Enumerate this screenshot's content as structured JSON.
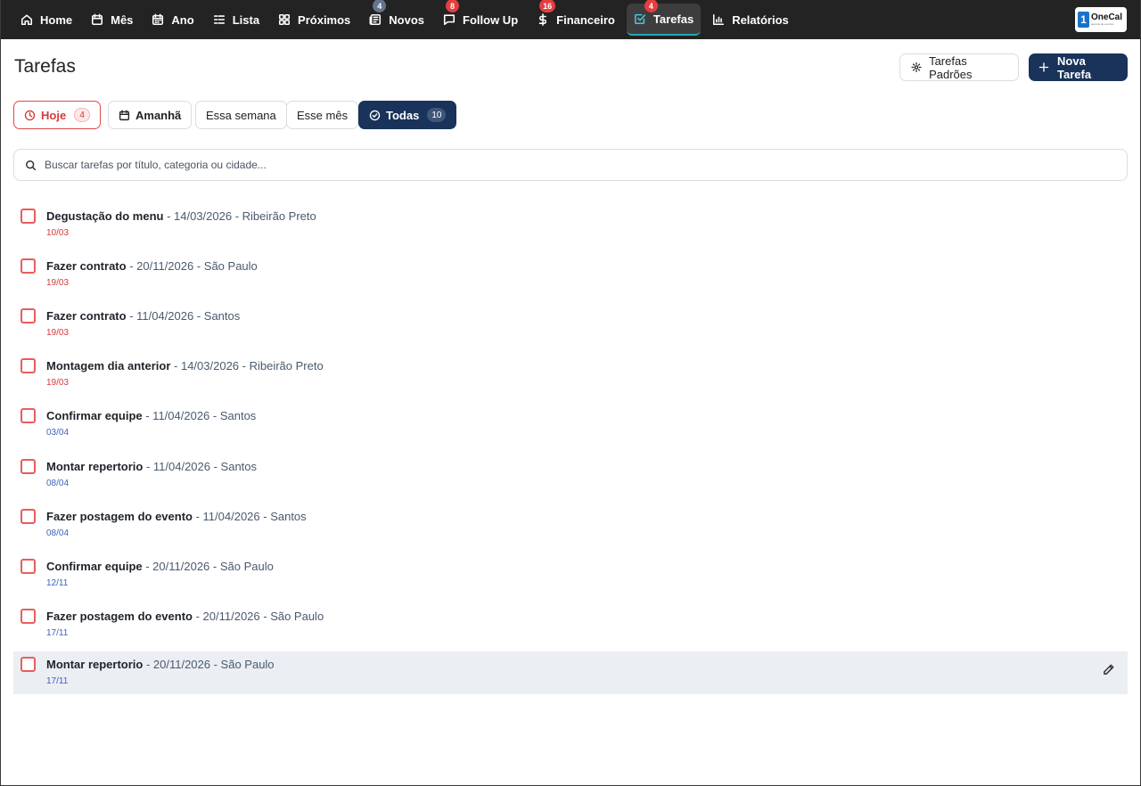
{
  "nav": {
    "items": [
      {
        "label": "Home",
        "icon": "home-icon"
      },
      {
        "label": "Mês",
        "icon": "calendar-icon"
      },
      {
        "label": "Ano",
        "icon": "calendar-grid-icon"
      },
      {
        "label": "Lista",
        "icon": "list-icon"
      },
      {
        "label": "Próximos",
        "icon": "grid-icon"
      },
      {
        "label": "Novos",
        "icon": "newspaper-icon",
        "badge": "4"
      },
      {
        "label": "Follow Up",
        "icon": "chat-icon",
        "badge": "8"
      },
      {
        "label": "Financeiro",
        "icon": "dollar-icon",
        "badge": "16"
      },
      {
        "label": "Tarefas",
        "icon": "checkbox-icon",
        "badge": "4"
      },
      {
        "label": "Relatórios",
        "icon": "bar-chart-icon"
      }
    ],
    "logo_char": "1",
    "logo_name": "OneCal",
    "logo_tagline": "agenda de eventos"
  },
  "header": {
    "title": "Tarefas",
    "default_tasks_label": "Tarefas Padrões",
    "new_task_label": "Nova Tarefa"
  },
  "filters": {
    "today": {
      "label": "Hoje",
      "count": "4"
    },
    "tomorrow": {
      "label": "Amanhã"
    },
    "week": {
      "label": "Essa semana"
    },
    "month": {
      "label": "Esse mês"
    },
    "all": {
      "label": "Todas",
      "count": "10"
    }
  },
  "search": {
    "placeholder": "Buscar tarefas por título, categoria ou cidade..."
  },
  "tasks": [
    {
      "name": "Degustação do menu",
      "meta": " - 14/03/2026 - Ribeirão Preto",
      "due": "10/03"
    },
    {
      "name": "Fazer contrato",
      "meta": " - 20/11/2026 - São Paulo",
      "due": "19/03"
    },
    {
      "name": "Fazer contrato",
      "meta": " - 11/04/2026 - Santos",
      "due": "19/03"
    },
    {
      "name": "Montagem dia anterior",
      "meta": " - 14/03/2026 - Ribeirão Preto",
      "due": "19/03"
    },
    {
      "name": "Confirmar equipe",
      "meta": " - 11/04/2026 - Santos",
      "due": "03/04"
    },
    {
      "name": "Montar repertorio",
      "meta": " - 11/04/2026 - Santos",
      "due": "08/04"
    },
    {
      "name": "Fazer postagem do evento",
      "meta": " - 11/04/2026 - Santos",
      "due": "08/04"
    },
    {
      "name": "Confirmar equipe",
      "meta": " - 20/11/2026 - São Paulo",
      "due": "12/11"
    },
    {
      "name": "Fazer postagem do evento",
      "meta": " - 20/11/2026 - São Paulo",
      "due": "17/11"
    },
    {
      "name": "Montar repertorio",
      "meta": " - 20/11/2026 - São Paulo",
      "due": "17/11"
    }
  ],
  "colors": {
    "nav_bg": "#232323",
    "primary": "#19335a",
    "overdue": "#d63a3a",
    "upcoming": "#3b64b8",
    "checkbox": "#e85d5d",
    "active_accent": "#2aa3b8"
  }
}
